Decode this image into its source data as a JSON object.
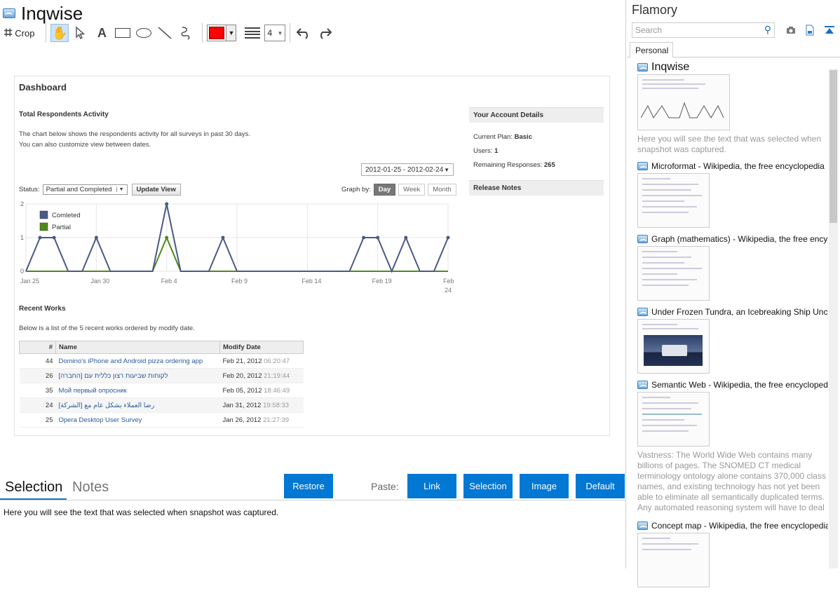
{
  "window": {
    "title": "Inqwise"
  },
  "toolbar": {
    "crop_label": "Crop",
    "line_width": "4",
    "stroke_color": "#ff0000",
    "tools": [
      "hand-icon",
      "pointer-icon",
      "text-icon",
      "rectangle-icon",
      "ellipse-icon",
      "line-icon",
      "freehand-icon",
      "undo-icon",
      "redo-icon"
    ]
  },
  "snapshot": {
    "dashboard_title": "Dashboard",
    "activity_title": "Total Respondents Activity",
    "activity_desc_1": "The chart below shows the respondents activity for all surveys in past 30 days.",
    "activity_desc_2": "You can also customize view between dates.",
    "date_range": "2012-01-25 - 2012-02-24",
    "status_label": "Status:",
    "status_value": "Partial and Completed",
    "update_button": "Update View",
    "graph_by_label": "Graph by:",
    "graph_by_options": [
      "Day",
      "Week",
      "Month"
    ],
    "graph_by_selected": "Day",
    "account": {
      "title": "Your Account Details",
      "plan_label": "Current Plan:",
      "plan_value": "Basic",
      "users_label": "Users:",
      "users_value": "1",
      "responses_label": "Remaining Responses:",
      "responses_value": "265"
    },
    "release_notes": "Release Notes",
    "recent_title": "Recent Works",
    "recent_desc": "Below is a list of the 5 recent works ordered by modify date.",
    "table": {
      "headers": [
        "#",
        "Name",
        "Modify Date"
      ],
      "rows": [
        {
          "num": "44",
          "name": "Domino's iPhone and Android pizza ordering app",
          "date": "Feb 21, 2012",
          "time": "06:20:47"
        },
        {
          "num": "26",
          "name": "[לקוחות שביעות רצון כללית עם [החברה",
          "date": "Feb 20, 2012",
          "time": "21:19:44"
        },
        {
          "num": "35",
          "name": "Мой первый опросник",
          "date": "Feb 05, 2012",
          "time": "18:46:49"
        },
        {
          "num": "24",
          "name": "[رضا العملاء بشكل عام مع [الشركة",
          "date": "Jan 31, 2012",
          "time": "19:58:33"
        },
        {
          "num": "25",
          "name": "Opera Desktop User Survey",
          "date": "Jan 26, 2012",
          "time": "21:27:39"
        }
      ]
    }
  },
  "chart_data": {
    "type": "line",
    "x": [
      "Jan 25",
      "Jan 26",
      "Jan 27",
      "Jan 28",
      "Jan 29",
      "Jan 30",
      "Jan 31",
      "Feb 1",
      "Feb 2",
      "Feb 3",
      "Feb 4",
      "Feb 5",
      "Feb 6",
      "Feb 7",
      "Feb 8",
      "Feb 9",
      "Feb 10",
      "Feb 11",
      "Feb 12",
      "Feb 13",
      "Feb 14",
      "Feb 15",
      "Feb 16",
      "Feb 17",
      "Feb 18",
      "Feb 19",
      "Feb 20",
      "Feb 21",
      "Feb 22",
      "Feb 23",
      "Feb 24"
    ],
    "tick_labels": [
      "Jan 25",
      "Jan 30",
      "Feb 4",
      "Feb 9",
      "Feb 14",
      "Feb 19",
      "Feb 24"
    ],
    "series": [
      {
        "name": "Comleted",
        "color": "#4a5a85",
        "values": [
          0,
          1,
          1,
          0,
          0,
          1,
          0,
          0,
          0,
          0,
          2,
          0,
          0,
          0,
          1,
          0,
          0,
          0,
          0,
          0,
          0,
          0,
          0,
          0,
          1,
          1,
          0,
          1,
          0,
          0,
          1
        ]
      },
      {
        "name": "Partial",
        "color": "#4e8a1a",
        "values": [
          0,
          0,
          0,
          0,
          0,
          0,
          0,
          0,
          0,
          0,
          1,
          0,
          0,
          0,
          0,
          0,
          0,
          0,
          0,
          0,
          0,
          0,
          0,
          0,
          0,
          0,
          0,
          0,
          0,
          0,
          0
        ]
      }
    ],
    "ylim": [
      0,
      2
    ],
    "yticks": [
      0,
      1,
      2
    ],
    "legend": "top-left",
    "grid": true
  },
  "bottom": {
    "tab_selection": "Selection",
    "tab_notes": "Notes",
    "restore_button": "Restore",
    "paste_label": "Paste:",
    "paste_buttons": [
      "Link",
      "Selection",
      "Image",
      "Default"
    ],
    "selection_text": "Here you will see the text that was selected when snapshot was captured."
  },
  "flamory": {
    "title": "Flamory",
    "search_placeholder": "Search",
    "tab_personal": "Personal",
    "items": [
      {
        "title": "Inqwise",
        "desc": "Here you will see the text that was selected when snapshot was captured."
      },
      {
        "title": "Microformat - Wikipedia, the free encyclopedia",
        "desc": ""
      },
      {
        "title": "Graph (mathematics) - Wikipedia, the free encyclopedia",
        "desc": ""
      },
      {
        "title": "Under Frozen Tundra, an Icebreaking Ship Uncovers",
        "desc": ""
      },
      {
        "title": "Semantic Web - Wikipedia, the free encyclopedia",
        "desc": "Vastness: The World Wide Web contains many billions of pages. The SNOMED CT medical terminology ontology alone contains 370,000 class names, and existing technology has not yet been able to eliminate all semantically duplicated terms. Any automated reasoning system will have to deal with truly huge inputs."
      },
      {
        "title": "Concept map - Wikipedia, the free encyclopedia",
        "desc": ""
      }
    ]
  }
}
